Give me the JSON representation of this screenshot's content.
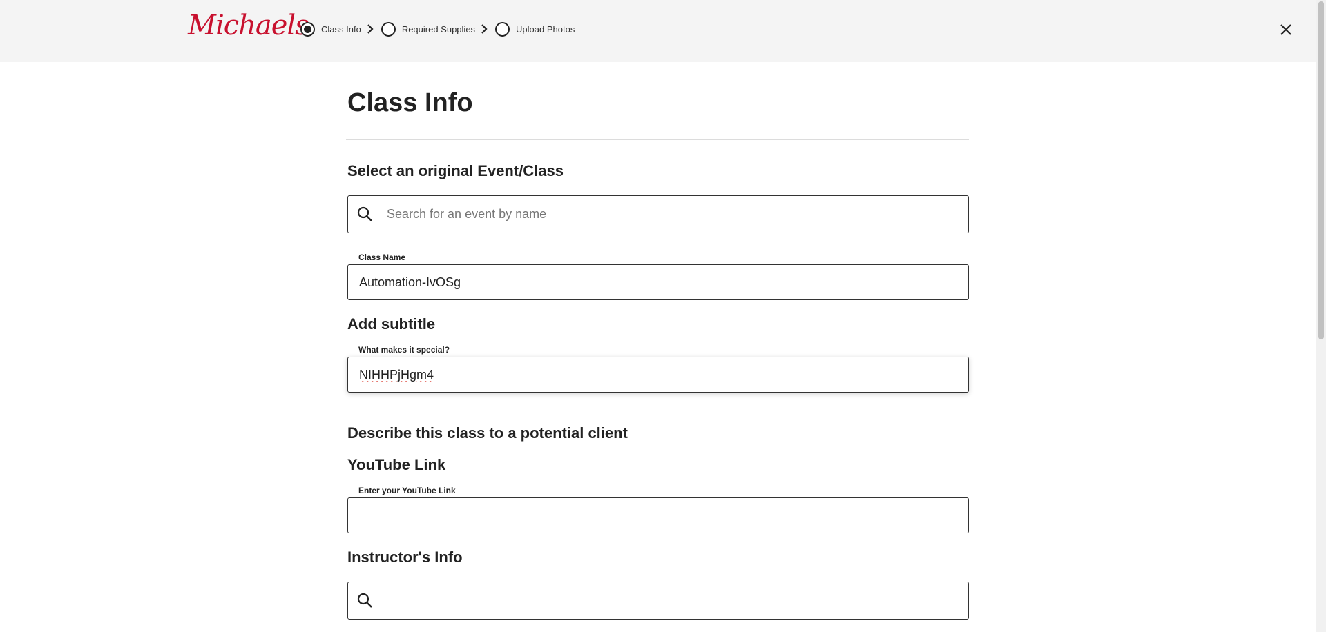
{
  "header": {
    "logo_text": "Michaels",
    "steps": [
      {
        "label": "Class Info",
        "active": true
      },
      {
        "label": "Required Supplies",
        "active": false
      },
      {
        "label": "Upload Photos",
        "active": false
      }
    ],
    "close_icon": "close-icon"
  },
  "main": {
    "page_title": "Class Info",
    "select_event": {
      "heading": "Select an original Event/Class",
      "placeholder": "Search for an event by name"
    },
    "class_name": {
      "label": "Class Name",
      "value": "Automation-IvOSg"
    },
    "subtitle": {
      "heading": "Add subtitle",
      "label": "What makes it special?",
      "value": "NIHHPjHgm4"
    },
    "describe": {
      "heading": "Describe this class to a potential client"
    },
    "youtube": {
      "heading": "YouTube Link",
      "label": "Enter your YouTube Link",
      "value": ""
    },
    "instructor": {
      "heading": "Instructor's Info",
      "value": ""
    }
  },
  "colors": {
    "brand": "#c8102e",
    "header_bg": "#f4f4f4",
    "border": "#333333"
  }
}
